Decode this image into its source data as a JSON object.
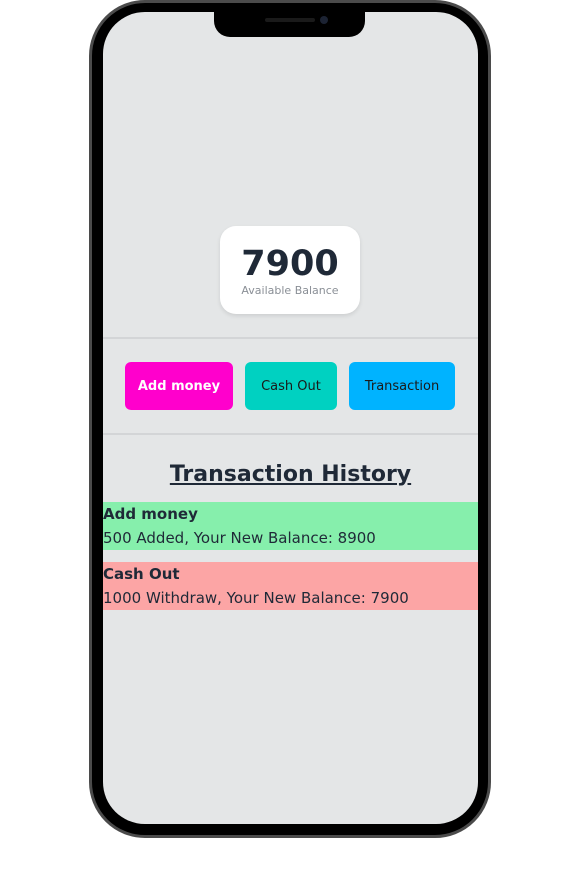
{
  "colors": {
    "screen_bg": "#e4e6e7",
    "add_money_button": "#ff00cc",
    "cash_out_button": "#00d1c1",
    "transaction_button": "#00b3ff",
    "add_money_entry": "#86efac",
    "cash_out_entry": "#fca5a5"
  },
  "balance": {
    "amount": "7900",
    "label": "Available Balance"
  },
  "actions": {
    "add_money_label": "Add money",
    "cash_out_label": "Cash Out",
    "transaction_label": "Transaction"
  },
  "history": {
    "title": "Transaction History",
    "items": [
      {
        "type": "Add money",
        "detail": "500 Added, Your New Balance: 8900",
        "color": "#86efac"
      },
      {
        "type": "Cash Out",
        "detail": "1000 Withdraw, Your New Balance: 7900",
        "color": "#fca5a5"
      }
    ]
  }
}
